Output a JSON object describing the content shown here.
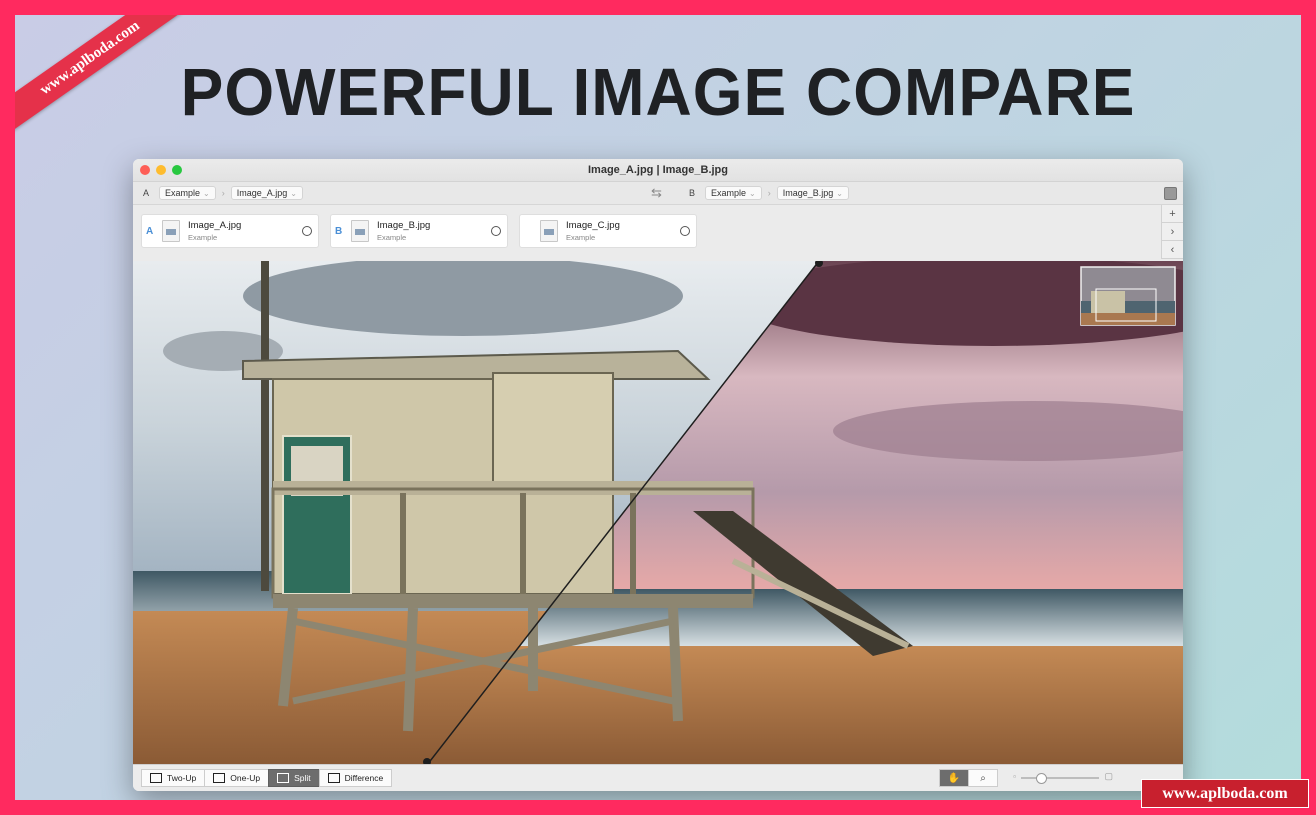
{
  "headline": "POWERFUL IMAGE COMPARE",
  "ribbon_text": "www.aplboda.com",
  "watermark_text": "www.aplboda.com",
  "window": {
    "title": "Image_A.jpg | Image_B.jpg"
  },
  "pathbar": {
    "a": {
      "letter": "A",
      "folder": "Example",
      "file": "Image_A.jpg"
    },
    "b": {
      "letter": "B",
      "folder": "Example",
      "file": "Image_B.jpg"
    },
    "swap_icon": "swap-arrows"
  },
  "tray": {
    "cards": [
      {
        "letter": "A",
        "name": "Image_A.jpg",
        "folder": "Example"
      },
      {
        "letter": "B",
        "name": "Image_B.jpg",
        "folder": "Example"
      },
      {
        "letter": "",
        "name": "Image_C.jpg",
        "folder": "Example"
      }
    ],
    "side_buttons": [
      "+",
      "›",
      "‹"
    ]
  },
  "toolbar": {
    "modes": [
      {
        "label": "Two-Up",
        "icon": "two-up-icon",
        "active": false
      },
      {
        "label": "One-Up",
        "icon": "one-up-icon",
        "active": false
      },
      {
        "label": "Split",
        "icon": "split-icon",
        "active": true
      },
      {
        "label": "Difference",
        "icon": "difference-icon",
        "active": false
      }
    ],
    "tools": [
      {
        "icon": "hand-icon",
        "glyph": "✋",
        "active": true
      },
      {
        "icon": "magnify-icon",
        "glyph": "⌕",
        "active": false
      }
    ],
    "zoom_level": 0.25
  },
  "colors": {
    "border": "#ff2a5f",
    "ribbon": "#e5314a",
    "watermark": "#c8202e",
    "active_mode": "#6d6d6d"
  }
}
